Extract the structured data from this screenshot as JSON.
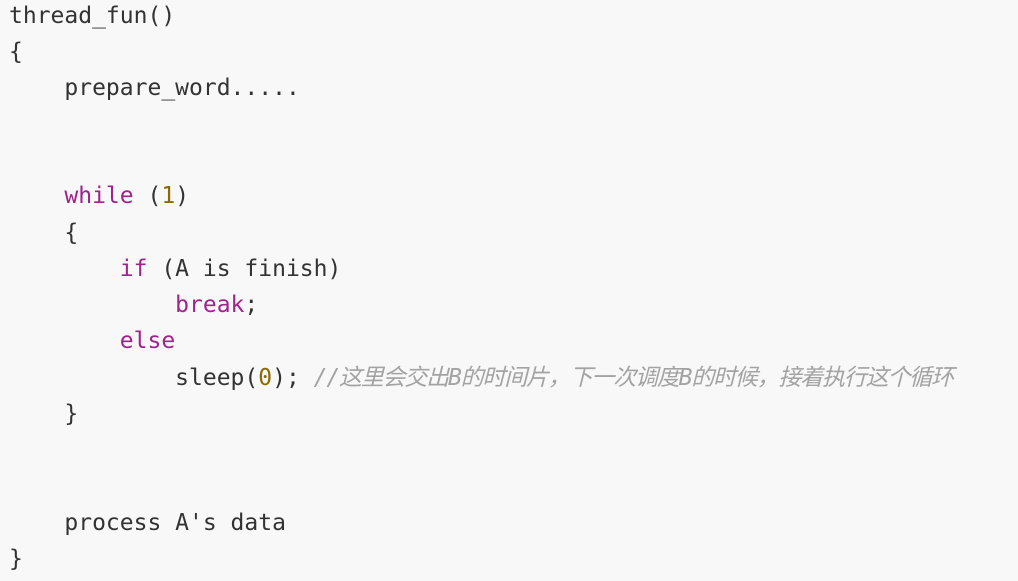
{
  "code": {
    "line1": "thread_fun()",
    "line2": "{",
    "line3_indent": "    ",
    "line3": "prepare_word.....",
    "line6_indent": "    ",
    "line6_kw": "while",
    "line6_sp": " (",
    "line6_num": "1",
    "line6_close": ")",
    "line7_indent": "    ",
    "line7": "{",
    "line8_indent": "        ",
    "line8_kw": "if",
    "line8_rest": " (A is finish)",
    "line9_indent": "            ",
    "line9_kw": "break",
    "line9_rest": ";",
    "line10_indent": "        ",
    "line10_kw": "else",
    "line11_indent": "            ",
    "line11_fn": "sleep(",
    "line11_num": "0",
    "line11_rest": "); ",
    "line11_comment": "//这里会交出B的时间片，下一次调度B的时候，接着执行这个循环",
    "line12_indent": "    ",
    "line12": "}",
    "line15_indent": "    ",
    "line15": "process A's data",
    "line16": "}"
  }
}
